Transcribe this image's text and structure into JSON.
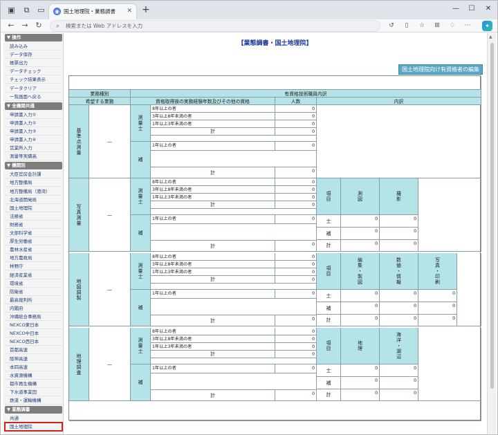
{
  "browser": {
    "tab_title": "国土地理院・業務調書",
    "address_placeholder": "検索または Web アドレスを入力"
  },
  "sidebar": {
    "sections": [
      {
        "title": "▼ 操作",
        "items": [
          "読み込み",
          "データ保存",
          "帳票出力",
          "データチェック",
          "チェック結果表示",
          "データクリア",
          "一覧画面へ戻る"
        ]
      },
      {
        "title": "▼ 全機関共通",
        "items": [
          "申請書入力①",
          "申請書入力②",
          "申請書入力③",
          "申請書入力④",
          "営業所入力",
          "測量等実績高"
        ]
      },
      {
        "title": "▼ 機関別",
        "items": [
          "大臣官房会計課",
          "地方整備局",
          "地方整備局（港湾）",
          "北海道開発局",
          "国土地理院",
          "法務省",
          "財務省",
          "文部科学省",
          "厚生労働省",
          "農林水産省",
          "地方農政局",
          "林野庁",
          "経済産業省",
          "環境省",
          "防衛省",
          "最高裁判所",
          "内閣府",
          "沖縄総合事務局",
          "NEXCO東日本",
          "NEXCO中日本",
          "NEXCO西日本",
          "首都高速",
          "阪神高速",
          "本四高速",
          "水資源機構",
          "都市再生機構",
          "下水道事業団",
          "鉄道・運輸機構"
        ]
      },
      {
        "title": "▼ 業態調書",
        "items": [
          "共通",
          "国土地理院"
        ]
      }
    ]
  },
  "page": {
    "title": "【業態調書・国土地理院】",
    "edit_button": "国土地理院向け有資格者の編集"
  },
  "table": {
    "h_gyomu_shubetsu": "業務種別",
    "h_shokuin": "有資格技術職員内訳",
    "h_kibou": "希望する業務",
    "h_shikaku": "資格取得後の実務経験年数及びその他の資格",
    "h_ninzu": "人数",
    "h_uchiwake": "内訳",
    "dash": "—",
    "sokuryoshi": "測量士",
    "ho": "補",
    "kei": "計",
    "yr8": "8年以上の者",
    "yr3_8": "3年以上8年未満の者",
    "yr1_3": "1年以上3年未満の者",
    "yr1": "1年以上の者",
    "zero": "0",
    "koumoku": "項目",
    "shi": "士",
    "sections": [
      {
        "name": "基準点測量",
        "cols": []
      },
      {
        "name": "写真測量",
        "cols": [
          "測図",
          "撮影"
        ]
      },
      {
        "name": "地図調製",
        "cols": [
          "編集・製図",
          "数値・情報",
          "写真・印刷"
        ]
      },
      {
        "name": "地理調査",
        "cols": [
          "地理",
          "海洋・湖沼"
        ]
      }
    ]
  }
}
